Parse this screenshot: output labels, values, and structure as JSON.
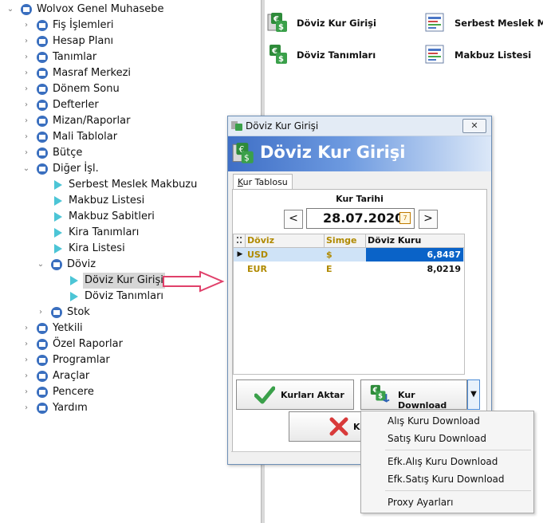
{
  "tree": {
    "root": "Wolvox Genel Muhasebe",
    "items": [
      {
        "label": "Fiş İşlemleri",
        "expanded": false
      },
      {
        "label": "Hesap Planı",
        "expanded": false
      },
      {
        "label": "Tanımlar",
        "expanded": false
      },
      {
        "label": "Masraf Merkezi",
        "expanded": false
      },
      {
        "label": "Dönem Sonu",
        "expanded": false
      },
      {
        "label": "Defterler",
        "expanded": false
      },
      {
        "label": "Mizan/Raporlar",
        "expanded": false
      },
      {
        "label": "Mali Tablolar",
        "expanded": false
      },
      {
        "label": "Bütçe",
        "expanded": false
      },
      {
        "label": "Diğer İşl.",
        "expanded": true
      }
    ],
    "diger_children": [
      "Serbest Meslek Makbuzu",
      "Makbuz Listesi",
      "Makbuz Sabitleri",
      "Kira Tanımları",
      "Kira Listesi"
    ],
    "doviz": {
      "label": "Döviz",
      "children": [
        "Döviz Kur Girişi",
        "Döviz Tanımları"
      ],
      "selected": "Döviz Kur Girişi"
    },
    "stok": "Stok",
    "bottom_items": [
      "Yetkili",
      "Özel Raporlar",
      "Programlar",
      "Araçlar",
      "Pencere",
      "Yardım"
    ]
  },
  "shortcuts": [
    {
      "label": "Döviz Kur Girişi",
      "icon": "currency-icon"
    },
    {
      "label": "Döviz Tanımları",
      "icon": "currency-icon"
    },
    {
      "label": "Serbest Meslek Mak",
      "icon": "report-icon"
    },
    {
      "label": "Makbuz Listesi",
      "icon": "report-icon"
    }
  ],
  "dialog": {
    "window_title": "Döviz Kur Girişi",
    "header_title": "Döviz Kur Girişi",
    "close_symbol": "✕",
    "tab_label": "Kur Tablosu",
    "tab_underlined_char": "K",
    "date_label": "Kur Tarihi",
    "date_value": "28.07.2020",
    "prev_symbol": "<",
    "next_symbol": ">",
    "grid": {
      "columns": [
        "Döviz",
        "Simge",
        "Döviz Kuru"
      ],
      "rows": [
        {
          "doviz": "USD",
          "simge": "$",
          "kur": "6,8487",
          "selected": true
        },
        {
          "doviz": "EUR",
          "simge": "E",
          "kur": "8,0219",
          "selected": false
        }
      ]
    },
    "btn_aktar": "Kurları Aktar",
    "btn_download": "Kur Download",
    "btn_hidden_partial": "K"
  },
  "menu": {
    "items": [
      "Alış Kuru Download",
      "Satış Kuru Download",
      "Efk.Alış Kuru Download",
      "Efk.Satış Kuru Download",
      "Proxy Ayarları"
    ]
  },
  "colors": {
    "accent": "#3a6fbf",
    "selection": "#0a63c8",
    "tree_leaf": "#4cc5d6",
    "arrow": "#e0406a"
  }
}
